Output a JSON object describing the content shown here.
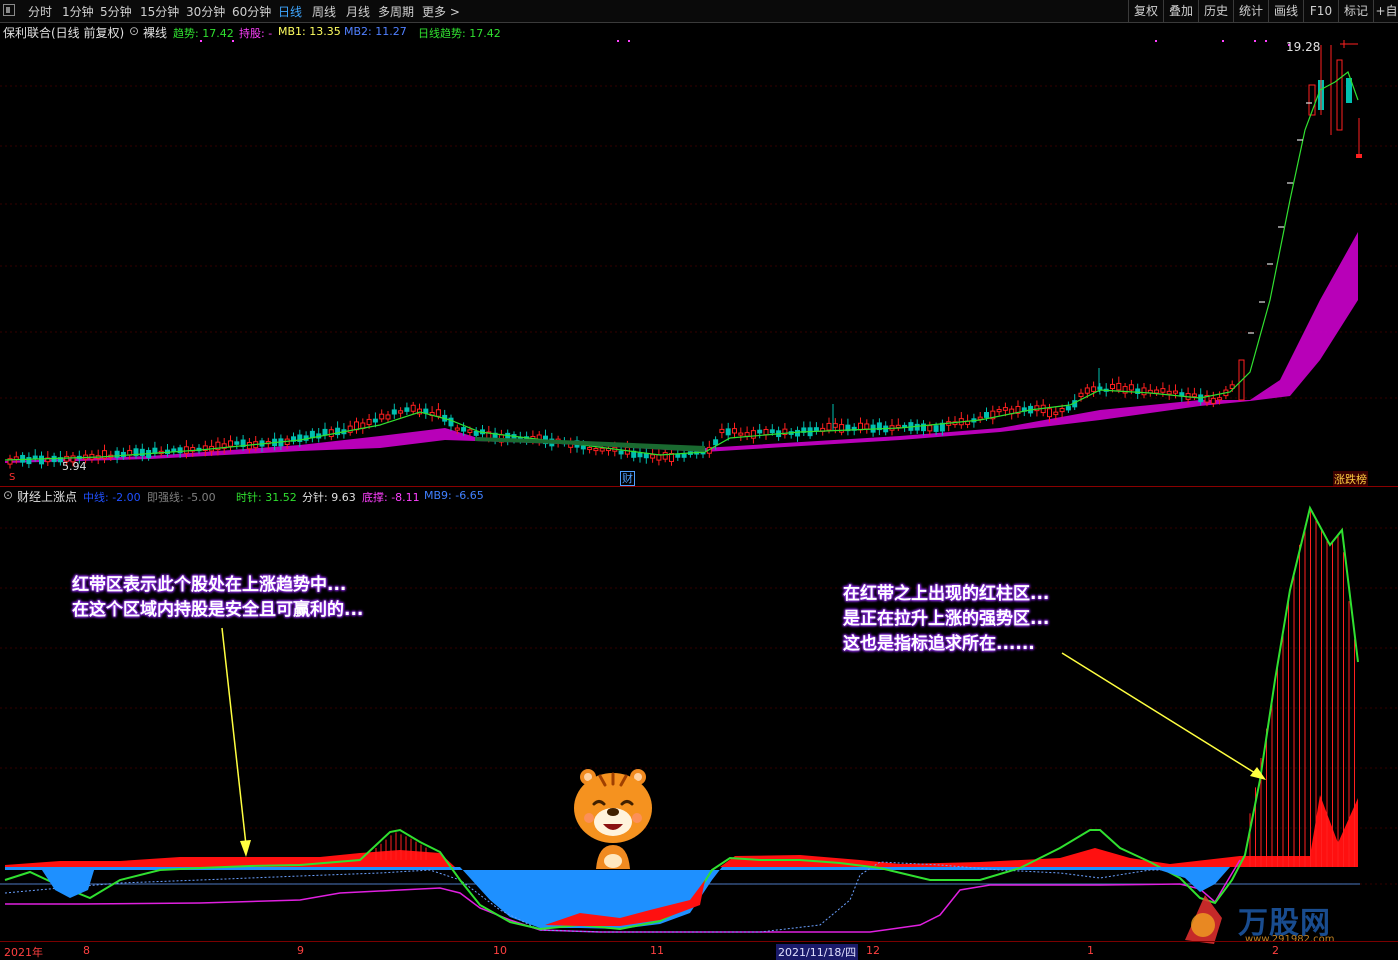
{
  "toolbar": {
    "periods": [
      "分时",
      "1分钟",
      "5分钟",
      "15分钟",
      "30分钟",
      "60分钟",
      "日线",
      "周线",
      "月线",
      "多周期",
      "更多 >"
    ],
    "active_period": "日线",
    "right_buttons": [
      "复权",
      "叠加",
      "历史",
      "统计",
      "画线",
      "F10",
      "标记",
      "+自选"
    ]
  },
  "main_chart": {
    "title": "保利联合(日线 前复权)",
    "indicator_name": "裸线",
    "legend": {
      "trend_label": "趋势: 17.42",
      "hold_label": "持股: -",
      "mb1_label": "MB1: 13.35",
      "mb2_label": "MB2: 11.27",
      "daily_trend_label": "日线趋势: 17.42"
    },
    "high_label": "19.28",
    "low_label": "5.94",
    "cai_marker": "财",
    "limit_label": "涨跌榜",
    "s_marker": "S"
  },
  "sub_chart": {
    "title": "财经上涨点",
    "legend": {
      "mid_label": "中线: -2.00",
      "strong_label": "即强线: -5.00",
      "hour_label": "时针: 31.52",
      "minute_label": "分针: 9.63",
      "bottom_label": "底撑: -8.11",
      "mb9_label": "MB9: -6.65"
    }
  },
  "annotations": {
    "left": [
      "红带区表示此个股处在上涨趋势中...",
      "在这个区域内持股是安全且可赢利的..."
    ],
    "right": [
      "在红带之上出现的红柱区...",
      "是正在拉升上涨的强势区...",
      "这也是指标追求所在......"
    ]
  },
  "date_axis": {
    "labels": [
      "2021年",
      "8",
      "9",
      "10",
      "11",
      "2021/11/18/四",
      "12",
      "1",
      "2"
    ]
  },
  "watermark": {
    "text": "万股网",
    "url": "www.291982.com"
  },
  "colors": {
    "up": "#ff2020",
    "down": "#00c0a0",
    "band": "#cc00cc",
    "green_line": "#30e030",
    "blue_area": "#1e90ff"
  }
}
